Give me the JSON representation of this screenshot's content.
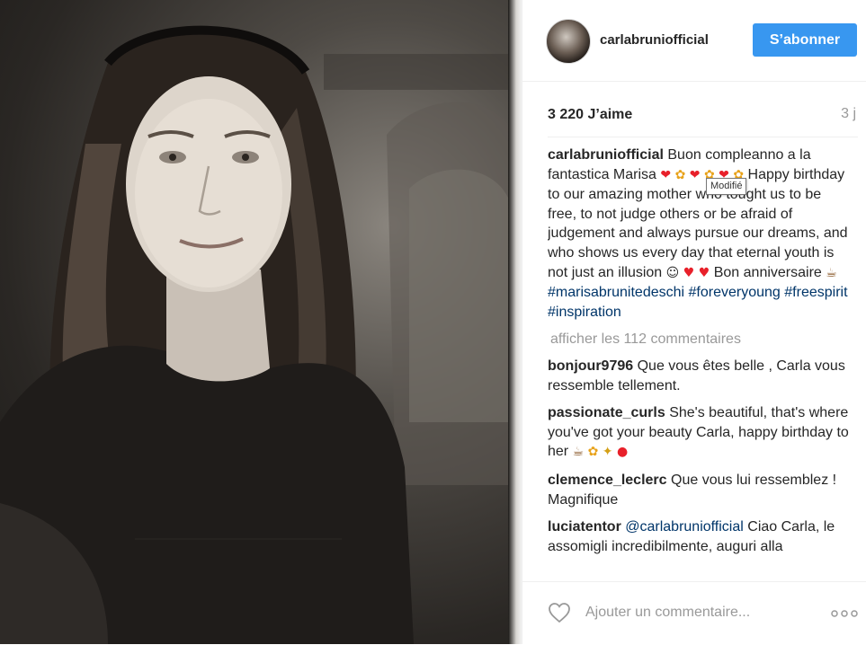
{
  "post": {
    "username": "carlabruniofficial",
    "follow_label": "S’abonner",
    "likes": "3 220 J’aime",
    "time": "3 j"
  },
  "caption": {
    "user": "carlabruniofficial",
    "text_1": "Buon compleanno a la fantastica Marisa",
    "text_2": "Happy birthday to our amazing mother who tought us to be free, to not judge others or be afraid of judgement and always pursue our dreams, and who shows us every day that eternal youth is not just an illusion",
    "text_3": "Bon anniversaire",
    "hashtags": [
      "#marisabrunitedeschi",
      "#foreveryoung",
      "#freespirit",
      "#inspiration"
    ]
  },
  "load_more": "afficher les 112 commentaires",
  "comments": [
    {
      "user": "bonjour9796",
      "text": "Que vous êtes belle , Carla vous ressemble tellement."
    },
    {
      "user": "passionate_curls",
      "text": "She's beautiful, that's where you've got your beauty Carla, happy birthday to her"
    },
    {
      "user": "clemence_leclerc",
      "text": "Que vous lui ressemblez ! Magnifique"
    },
    {
      "user": "luciatentor",
      "mention": "@carlabruniofficial",
      "text": "Ciao Carla, le assomigli incredibilmente, auguri alla"
    }
  ],
  "tooltip": "Modifié",
  "add_comment_placeholder": "Ajouter un commentaire...",
  "icons": {
    "like": "heart-outline-icon",
    "more": "more-options-icon",
    "emoji_heart": "sparkling-heart-emoji",
    "emoji_flower": "blossom-emoji",
    "emoji_cake": "birthday-cake-emoji"
  },
  "colors": {
    "follow_button": "#3897f0",
    "hashtag": "#003569",
    "muted": "#999999",
    "text": "#262626"
  }
}
